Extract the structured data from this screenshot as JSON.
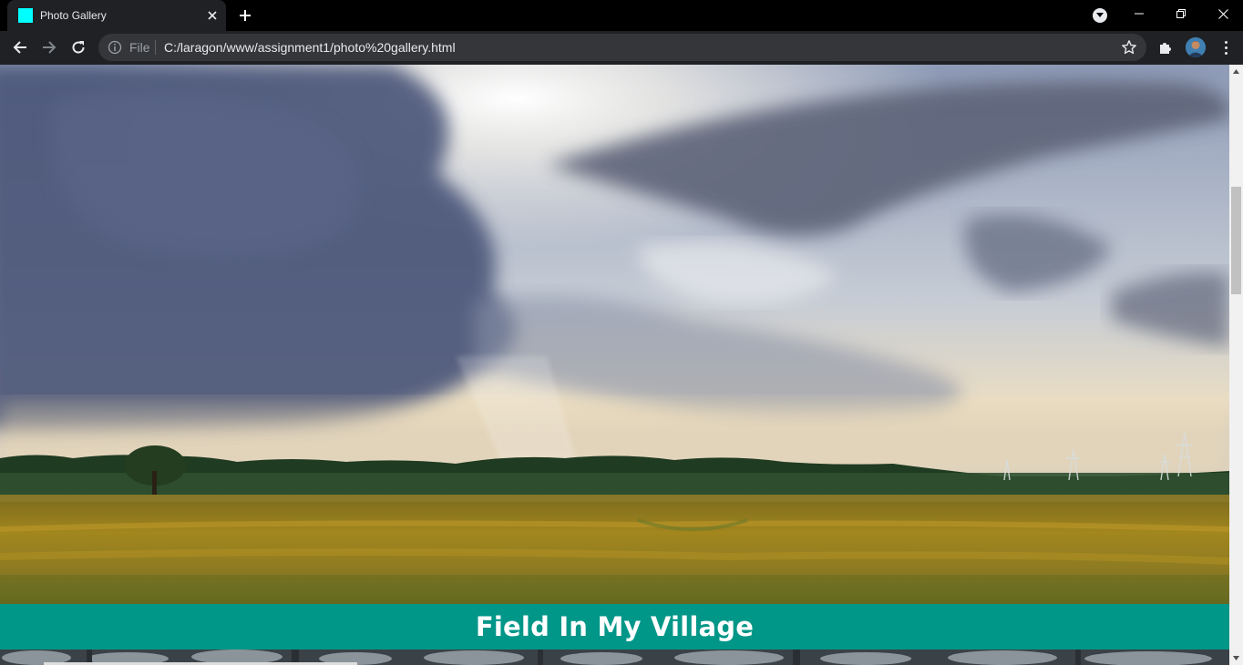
{
  "browser": {
    "tab": {
      "title": "Photo Gallery",
      "favicon_color": "#00ffff"
    },
    "address_bar": {
      "scheme_label": "File",
      "url": "C:/laragon/www/assignment1/photo%20gallery.html"
    },
    "icons": {
      "back": "back-arrow-icon",
      "forward": "forward-arrow-icon",
      "reload": "reload-icon",
      "info": "info-icon",
      "bookmark": "star-icon",
      "extensions": "puzzle-icon",
      "menu": "kebab-menu-icon"
    }
  },
  "page": {
    "photo": {
      "subject": "rice field under cloudy sky at sunset"
    },
    "caption": "Field In My Village",
    "caption_bar_color": "#009688"
  }
}
